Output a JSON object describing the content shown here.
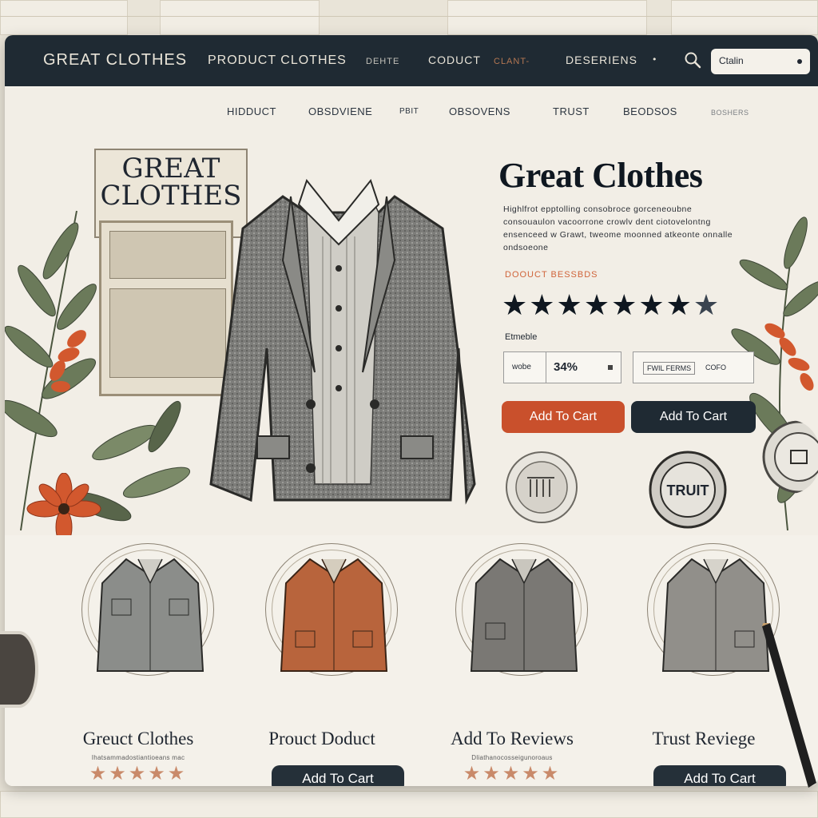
{
  "navbar": {
    "brand": "GREAT CLOTHES",
    "items": [
      "PRODUCT CLOTHES",
      "DEHTE",
      "CODUCT",
      "CLANT-",
      "DESERIENS"
    ],
    "caret": "•",
    "select_value": "Ctalin"
  },
  "subnav": [
    "HIDDUCT",
    "OBSDVIENE",
    "PBIT",
    "OBSOVENS",
    "TRUST",
    "BEODSOS",
    "BOSHERS"
  ],
  "hero": {
    "sign_title": [
      "GREAT",
      "CLOTHES"
    ],
    "title": "Great Clothes",
    "description": [
      "Highlfrot epptolling consobroce gorceneoubne",
      "consouaulon vacoorrone crowlv dent ciotovelontng",
      "ensenceed w Grawt, tweome moonned atkeonte onnalle",
      "ondsoeone"
    ],
    "orange_label": "DOOUCT  BESSBDS",
    "stars": "★★★★★★★",
    "star_extra": "★",
    "quantity_label": "Etmeble",
    "quantity_unit": "wobe",
    "quantity_value": "34%",
    "option_a": "FWIL FERMS",
    "option_b": "COFO",
    "add_to_cart_primary": "Add To Cart",
    "add_to_cart_secondary": "Add To Cart",
    "badge_trust": "TRUIT"
  },
  "products": [
    {
      "name": "Greuct Clothes",
      "subtitle": "Ihatsammadostiantioeans mac",
      "stars": "★★★★★",
      "button": null
    },
    {
      "name": "Prouct Doduct",
      "subtitle": "",
      "stars": null,
      "button": "Add To Cart"
    },
    {
      "name": "Add To Reviews",
      "subtitle": "Dliathanocosseigunoroaus",
      "stars": "★★★★★",
      "button": null
    },
    {
      "name": "Trust Reviege",
      "subtitle": "",
      "stars": null,
      "button": "Add To Cart"
    }
  ],
  "colors": {
    "navbar": "#1f2a33",
    "accent_orange": "#c9502c",
    "background": "#f4f1ea",
    "star_orange": "#c98a6a"
  },
  "icons": [
    "search-icon",
    "dropdown-dot-icon",
    "trust-badge-icon",
    "seal-badge-icon",
    "flower-icon",
    "leaf-icon"
  ]
}
